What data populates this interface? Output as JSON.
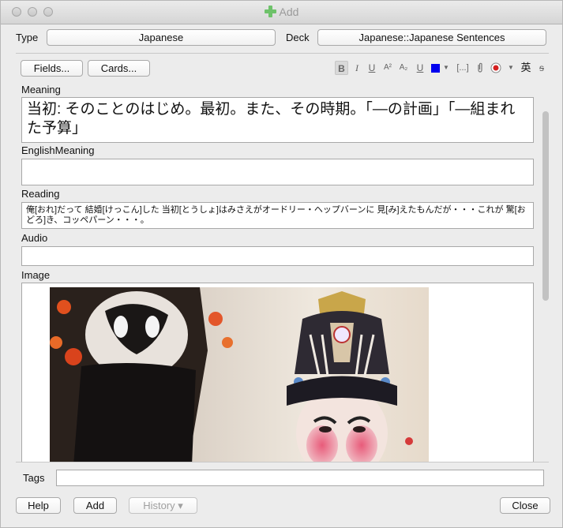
{
  "window": {
    "title": "Add"
  },
  "header": {
    "type_label": "Type",
    "type_value": "Japanese",
    "deck_label": "Deck",
    "deck_value": "Japanese::Japanese Sentences"
  },
  "toolbar": {
    "fields_label": "Fields...",
    "cards_label": "Cards...",
    "bold": "B",
    "italic": "I",
    "underline": "U",
    "superscript": "A²",
    "subscript": "A₂",
    "clear_format": "U",
    "text_color": "#0000ee",
    "cloze": "[...]",
    "kana_toggle": "英",
    "html_editor": "s"
  },
  "fields": [
    {
      "name": "Meaning",
      "value": "当初: そのことのはじめ。最初。また、その時期。「―の計画」「―組まれた予算」"
    },
    {
      "name": "EnglishMeaning",
      "value": ""
    },
    {
      "name": "Reading",
      "value": "俺[おれ]だって 結婚[けっこん]した 当初[とうしょ]はみさえがオードリー・ヘップバーンに 見[み]えたもんだが・・・これが 驚[おどろ]き、コッペパーン・・・。"
    },
    {
      "name": "Audio",
      "value": ""
    },
    {
      "name": "Image",
      "value": ""
    }
  ],
  "tags": {
    "label": "Tags",
    "value": ""
  },
  "footer": {
    "help_label": "Help",
    "add_label": "Add",
    "history_label": "History ▾",
    "close_label": "Close"
  }
}
